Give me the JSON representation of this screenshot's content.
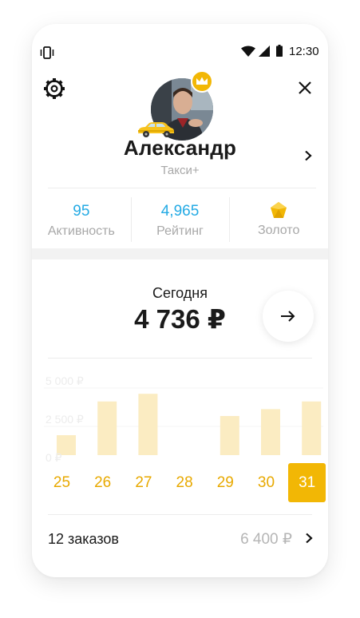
{
  "status_bar": {
    "time": "12:30"
  },
  "profile": {
    "name": "Александр",
    "tariff": "Такси+"
  },
  "stats": [
    {
      "value": "95",
      "label": "Активность"
    },
    {
      "value": "4,965",
      "label": "Рейтинг"
    },
    {
      "icon": "gold-gem-icon",
      "label": "Золото"
    }
  ],
  "earnings": {
    "period_label": "Сегодня",
    "amount": "4 736 ₽"
  },
  "chart_data": {
    "type": "bar",
    "categories": [
      "25",
      "26",
      "27",
      "28",
      "29",
      "30",
      "31"
    ],
    "values": [
      1300,
      3500,
      4000,
      0,
      2550,
      3000,
      3500
    ],
    "y_ticks": [
      "5 000 ₽",
      "2 500 ₽",
      "0 ₽"
    ],
    "y_tick_values": [
      5000,
      2500,
      0
    ],
    "ylim": [
      0,
      5000
    ],
    "selected_category": "31",
    "colors": {
      "bar": "#fbecc2",
      "selected": "#f2b705",
      "day_text": "#e8a900"
    }
  },
  "orders": {
    "count_label": "12 заказов",
    "sum": "6 400 ₽"
  },
  "colors": {
    "accent": "#f2b705",
    "stat_value": "#23aae4",
    "muted_text": "#a8a8a8"
  }
}
